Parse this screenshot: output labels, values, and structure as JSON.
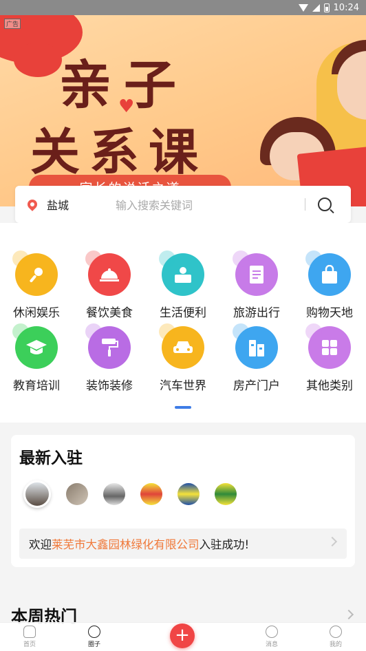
{
  "status_bar": {
    "time": "10:24"
  },
  "banner": {
    "ad_label": "广告",
    "title_line1": "亲子",
    "title_line2": "关系课",
    "subtitle": "家长的说话之道"
  },
  "search": {
    "city": "盐城",
    "placeholder": "输入搜索关键词"
  },
  "categories": [
    {
      "label": "休闲娱乐",
      "icon": "microphone-icon",
      "color": "#f7b51e"
    },
    {
      "label": "餐饮美食",
      "icon": "food-cloche-icon",
      "color": "#f04848"
    },
    {
      "label": "生活便利",
      "icon": "person-card-icon",
      "color": "#2fc3c9"
    },
    {
      "label": "旅游出行",
      "icon": "document-icon",
      "color": "#c77be8"
    },
    {
      "label": "购物天地",
      "icon": "shopping-bag-icon",
      "color": "#3ea6f0"
    },
    {
      "label": "教育培训",
      "icon": "graduation-cap-icon",
      "color": "#3ccf5a"
    },
    {
      "label": "装饰装修",
      "icon": "paint-roller-icon",
      "color": "#b96ce4"
    },
    {
      "label": "汽车世界",
      "icon": "car-icon",
      "color": "#f7b51e"
    },
    {
      "label": "房产门户",
      "icon": "building-icon",
      "color": "#3ea6f0"
    },
    {
      "label": "其他类别",
      "icon": "grid-icon",
      "color": "#c97be8"
    }
  ],
  "newest": {
    "title": "最新入驻",
    "welcome_prefix": "欢迎",
    "company": "莱芜市大鑫园林绿化有限公司",
    "welcome_suffix": "入驻成功!"
  },
  "weekly_hot": {
    "title": "本周热门"
  },
  "bottom_nav": {
    "home": "首页",
    "circle": "圈子",
    "messages": "消息",
    "mine": "我的"
  },
  "colors": {
    "accent": "#f04545",
    "highlight": "#f0793a",
    "indicator": "#3e7ce6"
  }
}
